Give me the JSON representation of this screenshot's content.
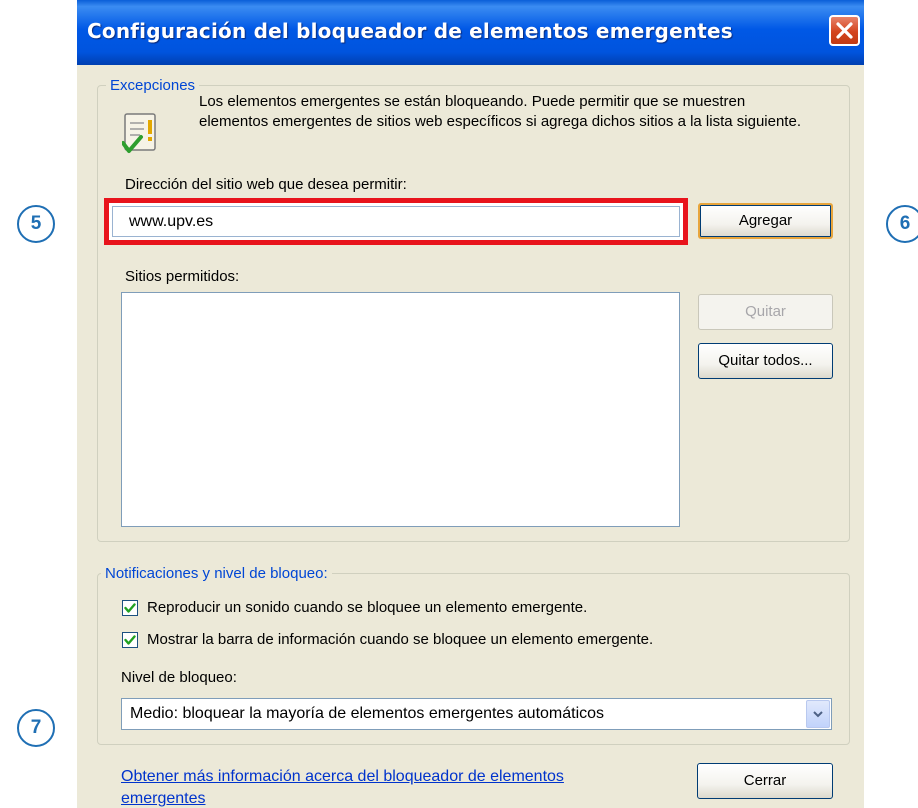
{
  "callouts": [
    "5",
    "6",
    "7"
  ],
  "window": {
    "title": "Configuración del bloqueador de elementos emergentes",
    "close_icon": "close-icon"
  },
  "exceptions": {
    "legend": "Excepciones",
    "description": "Los elementos emergentes se están bloqueando. Puede permitir que se muestren elementos emergentes de sitios web específicos si agrega dichos sitios a la lista siguiente.",
    "icon": "info-check-icon",
    "address_label": "Dirección del sitio web que desea permitir:",
    "address_value": "www.upv.es",
    "add_button": "Agregar",
    "allowed_label": "Sitios permitidos:",
    "allowed_sites": [],
    "remove_button": "Quitar",
    "remove_all_button": "Quitar todos..."
  },
  "notifications": {
    "legend": "Notificaciones y nivel de bloqueo:",
    "options": [
      {
        "label": "Reproducir un sonido cuando se bloquee un elemento emergente.",
        "checked": true
      },
      {
        "label": "Mostrar la barra de información cuando se bloquee un elemento emergente.",
        "checked": true
      }
    ],
    "level_label": "Nivel de bloqueo:",
    "level_value": "Medio: bloquear la mayoría de elementos emergentes automáticos"
  },
  "footer": {
    "link": "Obtener más información acerca del bloqueador de elementos emergentes",
    "close_button": "Cerrar"
  },
  "colors": {
    "highlight": "#e8141c",
    "callout": "#1f6fb4",
    "legend_text": "#0046d5",
    "titlebar": "#0054de"
  }
}
